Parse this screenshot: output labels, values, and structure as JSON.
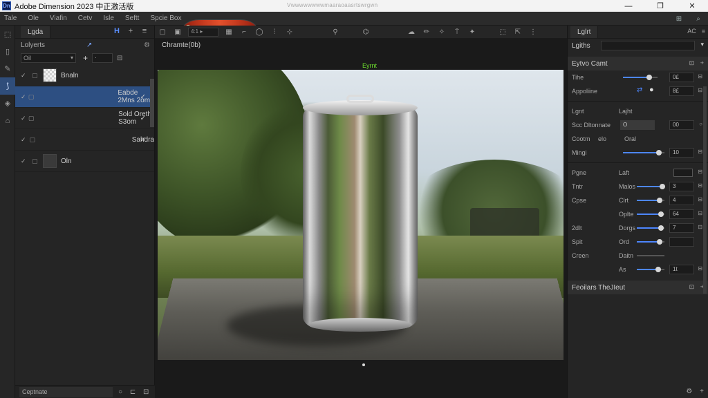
{
  "titlebar": {
    "logo_text": "Dn",
    "title": "Adobe Dimension 2023 中正激活版",
    "center_text": "Vwwwwwwwwmaaraoaasrtswrgwn",
    "minimize": "—",
    "maximize": "❐",
    "close": "✕"
  },
  "menubar": {
    "items": [
      "Tale",
      "Ole",
      "Viafin",
      "Cetv",
      "Isle",
      "Seftt",
      "Spcie Box"
    ],
    "right_icons": [
      "⊞",
      "⌕"
    ]
  },
  "layers_panel": {
    "tab": "Lgda",
    "sub_label": "Lolyerts",
    "sub_icon": "↗",
    "filter_value": "Oil",
    "filter_num": "·",
    "layers": [
      {
        "name": "Bnaln",
        "thumb": "checker",
        "selected": false,
        "check": ""
      },
      {
        "name": "Eabde 2Mns 2om",
        "thumb": "can",
        "selected": true,
        "check": "✓"
      },
      {
        "name": "Sold Oreth S3om",
        "thumb": "can",
        "selected": false,
        "check": "✓"
      },
      {
        "name": "Sahdra",
        "thumb": "can",
        "selected": false,
        "check": "✓"
      },
      {
        "name": "Oln",
        "thumb": "dark",
        "selected": false,
        "check": ""
      }
    ],
    "footer_label": "Ceptnate"
  },
  "viewport": {
    "camera_label": "Chramte(0b)",
    "light_label": "Eyrnt"
  },
  "properties": {
    "tab": "Lglrt",
    "tab_badge": "AC",
    "lights_label": "Lgiths",
    "section_title": "Eytvo Camt",
    "rows": [
      {
        "label": "Tihe",
        "value": "0£",
        "fill": 0.75
      },
      {
        "label": "Appoliine",
        "value": "8£"
      }
    ],
    "light_header": {
      "left": "Lgnt",
      "right": "Lajht"
    },
    "soc_label": "Scc Dltonnate",
    "soc_field": "O",
    "soc_value": "00",
    "cost_label": "Cootm",
    "cost_mid": "elo",
    "cost_right": "Oral",
    "mag_label": "Mingi",
    "mag_value": "10",
    "mag_fill": 0.86,
    "sub_rows": [
      {
        "label": "Pgne",
        "label2": "Laft",
        "value": ""
      },
      {
        "label": "Tntr",
        "label2": "Malos",
        "value": "3",
        "fill": 0.9
      },
      {
        "label": "Cpse",
        "label2": "Clrt",
        "value": "4",
        "fill": 0.8
      },
      {
        "label": "",
        "label2": "Oplte",
        "value": "64",
        "fill": 0.85
      },
      {
        "label": "2dlt",
        "label2": "Dorgs",
        "value": "7",
        "fill": 0.85
      },
      {
        "label": "Spit",
        "label2": "Ord",
        "value": "",
        "fill": 0.8
      },
      {
        "label": "Creen",
        "label2": "Daitn",
        "value": "",
        "fill": 0.0
      },
      {
        "label": "",
        "label2": "As",
        "value": "1t",
        "fill": 0.75
      }
    ],
    "footer_section": "Feoilars TheJIeut"
  }
}
